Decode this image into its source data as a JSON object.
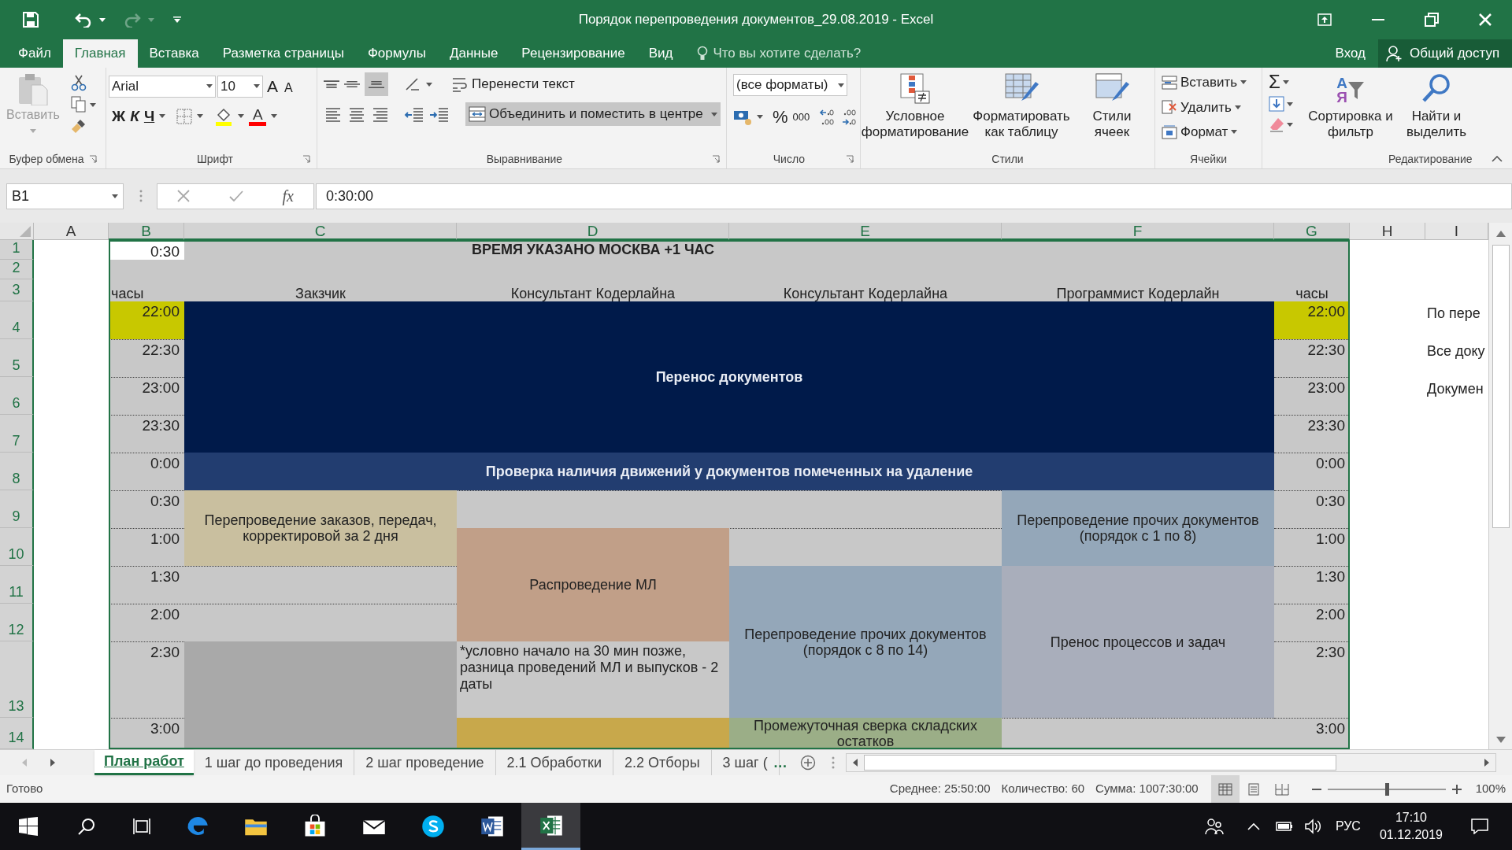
{
  "window": {
    "title": "Порядок перепроведения документов_29.08.2019 - Excel"
  },
  "ribbon_tabs": [
    {
      "label": "Файл",
      "selected": false
    },
    {
      "label": "Главная",
      "selected": true
    },
    {
      "label": "Вставка",
      "selected": false
    },
    {
      "label": "Разметка страницы",
      "selected": false
    },
    {
      "label": "Формулы",
      "selected": false
    },
    {
      "label": "Данные",
      "selected": false
    },
    {
      "label": "Рецензирование",
      "selected": false
    },
    {
      "label": "Вид",
      "selected": false
    }
  ],
  "tell_me": {
    "placeholder": "Что вы хотите сделать?"
  },
  "account": {
    "sign_in": "Вход",
    "share": "Общий доступ"
  },
  "ribbon": {
    "clipboard": {
      "paste": "Вставить",
      "label": "Буфер обмена"
    },
    "font": {
      "name": "Arial",
      "size": "10",
      "grow": "A",
      "shrink": "A",
      "bold": "Ж",
      "italic": "К",
      "underline": "Ч",
      "color_letter": "A",
      "label": "Шрифт"
    },
    "alignment": {
      "wrap": "Перенести текст",
      "merge": "Объединить и поместить в центре",
      "label": "Выравнивание"
    },
    "number": {
      "format": "(все форматы)",
      "percent": "%",
      "thousands": "000",
      "label": "Число"
    },
    "styles": {
      "conditional": "Условное форматирование",
      "as_table": "Форматировать как таблицу",
      "cell_styles": "Стили ячеек",
      "label": "Стили"
    },
    "cells": {
      "insert": "Вставить",
      "delete": "Удалить",
      "format": "Формат",
      "label": "Ячейки"
    },
    "editing": {
      "sum": "Σ",
      "sort_top": "А",
      "sort_bottom": "Я",
      "sort": "Сортировка и фильтр",
      "find": "Найти и выделить",
      "label": "Редактирование"
    }
  },
  "formula_bar": {
    "name_box": "B1",
    "fx": "fx",
    "value": "0:30:00"
  },
  "sheet": {
    "columns": [
      {
        "label": "A",
        "selected": false
      },
      {
        "label": "B",
        "selected": true
      },
      {
        "label": "C",
        "selected": true
      },
      {
        "label": "D",
        "selected": true
      },
      {
        "label": "E",
        "selected": true
      },
      {
        "label": "F",
        "selected": true
      },
      {
        "label": "G",
        "selected": true
      },
      {
        "label": "H",
        "selected": false
      },
      {
        "label": "I",
        "selected": false
      }
    ],
    "rows": [
      {
        "label": "1",
        "selected": true
      },
      {
        "label": "2",
        "selected": true
      },
      {
        "label": "3",
        "selected": true
      },
      {
        "label": "4",
        "selected": true
      },
      {
        "label": "5",
        "selected": true
      },
      {
        "label": "6",
        "selected": true
      },
      {
        "label": "7",
        "selected": true
      },
      {
        "label": "8",
        "selected": true
      },
      {
        "label": "9",
        "selected": true
      },
      {
        "label": "10",
        "selected": true
      },
      {
        "label": "11",
        "selected": true
      },
      {
        "label": "12",
        "selected": true
      },
      {
        "label": "13",
        "selected": true
      },
      {
        "label": "14",
        "selected": true
      }
    ],
    "b1": "0:30",
    "title": "ВРЕМЯ УКАЗАНО МОСКВА +1 ЧАС",
    "headers": [
      "часы",
      "Закзчик",
      "Консультант Кодерлайна",
      "Консультант Кодерлайна",
      "Программист Кодерлайн",
      "часы"
    ],
    "time_column_b": [
      {
        "time": "22:00",
        "highlighted": true
      },
      {
        "time": "22:30",
        "highlighted": false
      },
      {
        "time": "23:00",
        "highlighted": false
      },
      {
        "time": "23:30",
        "highlighted": false
      },
      {
        "time": "0:00",
        "highlighted": false
      },
      {
        "time": "0:30",
        "highlighted": false
      },
      {
        "time": "1:00",
        "highlighted": false
      },
      {
        "time": "1:30",
        "highlighted": false
      },
      {
        "time": "2:00",
        "highlighted": false
      },
      {
        "time": "2:30",
        "highlighted": false
      },
      {
        "time": "3:00",
        "highlighted": false
      }
    ],
    "time_column_g": [
      {
        "time": "22:00",
        "highlighted": true
      },
      {
        "time": "22:30",
        "highlighted": false
      },
      {
        "time": "23:00",
        "highlighted": false
      },
      {
        "time": "23:30",
        "highlighted": false
      },
      {
        "time": "0:00",
        "highlighted": false
      },
      {
        "time": "0:30",
        "highlighted": false
      },
      {
        "time": "1:00",
        "highlighted": false
      },
      {
        "time": "1:30",
        "highlighted": false
      },
      {
        "time": "2:00",
        "highlighted": false
      },
      {
        "time": "2:30",
        "highlighted": false
      },
      {
        "time": "3:00",
        "highlighted": false
      }
    ],
    "blocks": [
      {
        "kind": "banner",
        "text": "Перенос документов",
        "color": "#001a4a"
      },
      {
        "kind": "banner",
        "text": "Проверка наличия движений у документов помеченных на удаление",
        "color": "#223d70"
      },
      {
        "kind": "task",
        "text": "Перепроведение заказов, передач, корректировой за 2 дня",
        "color": "#c9bf9f"
      },
      {
        "kind": "task",
        "text": "Перепроведение прочих документов (порядок с 1 по 8)",
        "color": "#94a7b9"
      },
      {
        "kind": "task",
        "text": "Распроведение МЛ",
        "color": "#c19f88"
      },
      {
        "kind": "task",
        "text": "Перепроведение прочих документов (порядок с 8 по 14)",
        "color": "#94a7b9"
      },
      {
        "kind": "task",
        "text": "Пренос процессов и задач",
        "color": "#a9aebb"
      },
      {
        "kind": "note",
        "text": "*условно начало на 30 мин позже, разница проведений МЛ и выпусков - 2 даты",
        "color": "#c8c8c8"
      },
      {
        "kind": "fill",
        "color": "#a9a9a9"
      },
      {
        "kind": "fill",
        "color": "#c8a84b"
      },
      {
        "kind": "task",
        "text": "Промежуточная сверка складских остатков",
        "color": "#9bae87"
      }
    ],
    "side_notes": [
      "По пере",
      "Все доку",
      "Докумен"
    ]
  },
  "sheet_tabs": [
    {
      "label": "План работ",
      "selected": true
    },
    {
      "label": "1 шаг до проведения",
      "selected": false
    },
    {
      "label": "2 шаг проведение",
      "selected": false
    },
    {
      "label": "2.1 Обработки",
      "selected": false
    },
    {
      "label": "2.2 Отборы",
      "selected": false
    },
    {
      "label": "3 шаг (",
      "selected": false
    }
  ],
  "more_tabs": "…",
  "status_bar": {
    "ready": "Готово",
    "average": "Среднее: 25:50:00",
    "count": "Количество: 60",
    "sum": "Сумма: 1007:30:00",
    "zoom": "100%",
    "zoom_slider": {
      "level": 0.5
    },
    "page_views": [
      {
        "kind": "normal",
        "selected": true
      },
      {
        "kind": "page_layout",
        "selected": false
      },
      {
        "kind": "page_break",
        "selected": false
      }
    ]
  },
  "taskbar": {
    "apps": [
      {
        "kind": "edge",
        "active": false
      },
      {
        "kind": "folder",
        "active": false
      },
      {
        "kind": "store",
        "active": false
      },
      {
        "kind": "mail",
        "active": false
      },
      {
        "kind": "skype",
        "active": false
      },
      {
        "kind": "word",
        "active": false
      },
      {
        "kind": "excel",
        "active": true
      }
    ],
    "language": "РУС",
    "time": "17:10",
    "date": "01.12.2019"
  }
}
